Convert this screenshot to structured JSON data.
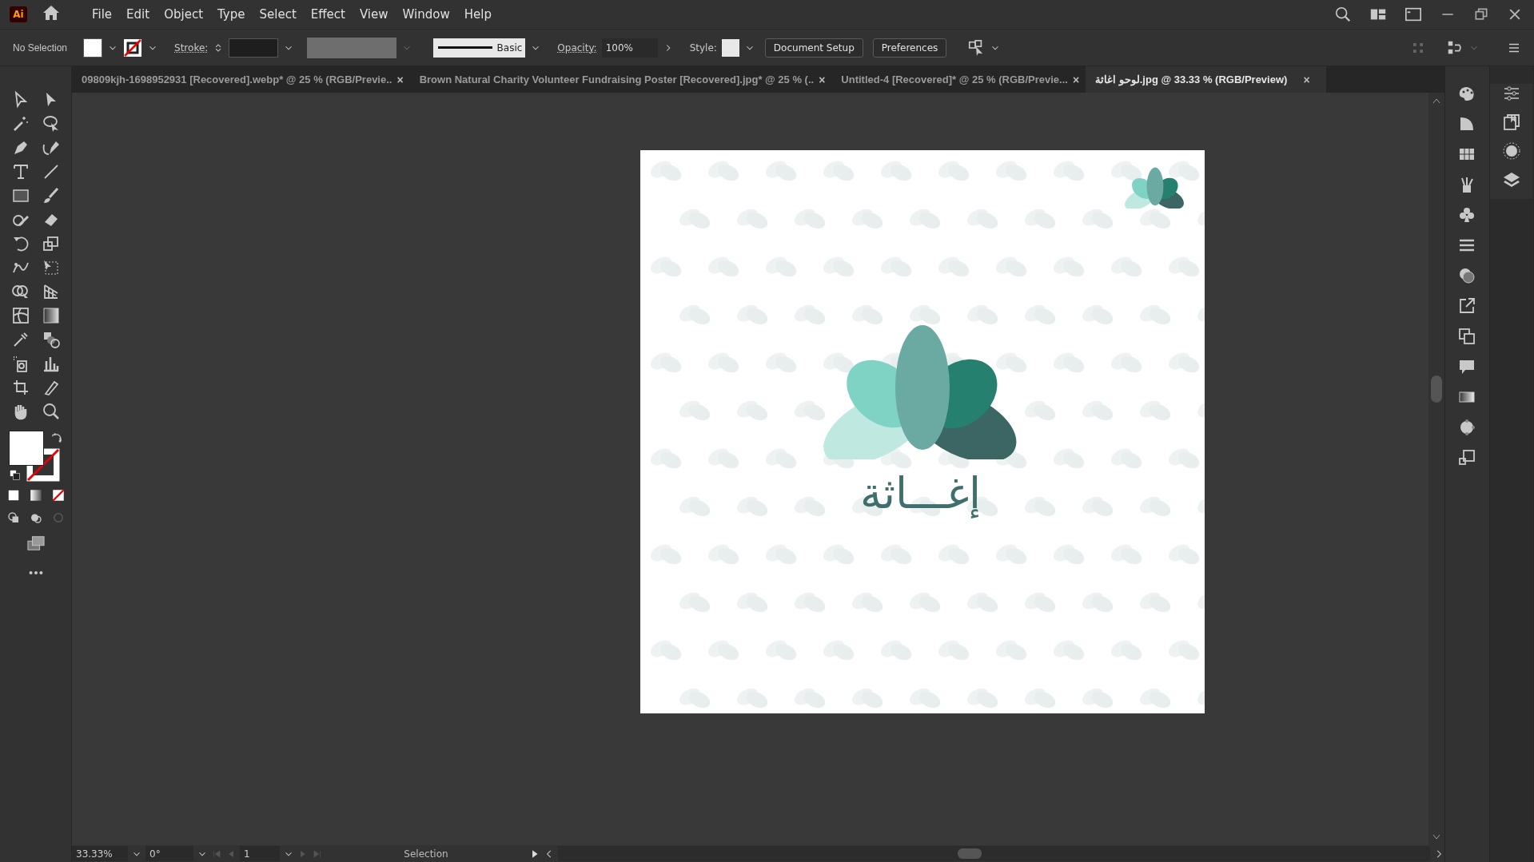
{
  "app": {
    "logo": "Ai"
  },
  "menu": [
    "File",
    "Edit",
    "Object",
    "Type",
    "Select",
    "Effect",
    "View",
    "Window",
    "Help"
  ],
  "control_bar": {
    "selection": "No Selection",
    "stroke_label": "Stroke:",
    "brush": "Basic",
    "opacity_label": "Opacity:",
    "opacity": "100%",
    "style_label": "Style:",
    "buttons": [
      "Document Setup",
      "Preferences"
    ]
  },
  "tabs": [
    {
      "label": "09809kjh-1698952931 [Recovered].webp* @ 25 % (RGB/Previe..",
      "close": "×",
      "selected": false
    },
    {
      "label": "Brown Natural Charity Volunteer Fundraising Poster [Recovered].jpg* @ 25 % (..",
      "close": "×",
      "selected": false
    },
    {
      "label": "Untitled-4 [Recovered]* @ 25 % (RGB/Previe...",
      "close": "×",
      "selected": false
    },
    {
      "label": "لوحو اغاثة.jpg @ 33.33 % (RGB/Preview)",
      "close": "×",
      "selected": true
    }
  ],
  "artboard": {
    "logo_text": "إغـــاثة"
  },
  "status_bar": {
    "zoom": "33.33%",
    "rotation": "0°",
    "artboard": "1",
    "tool": "Selection"
  }
}
